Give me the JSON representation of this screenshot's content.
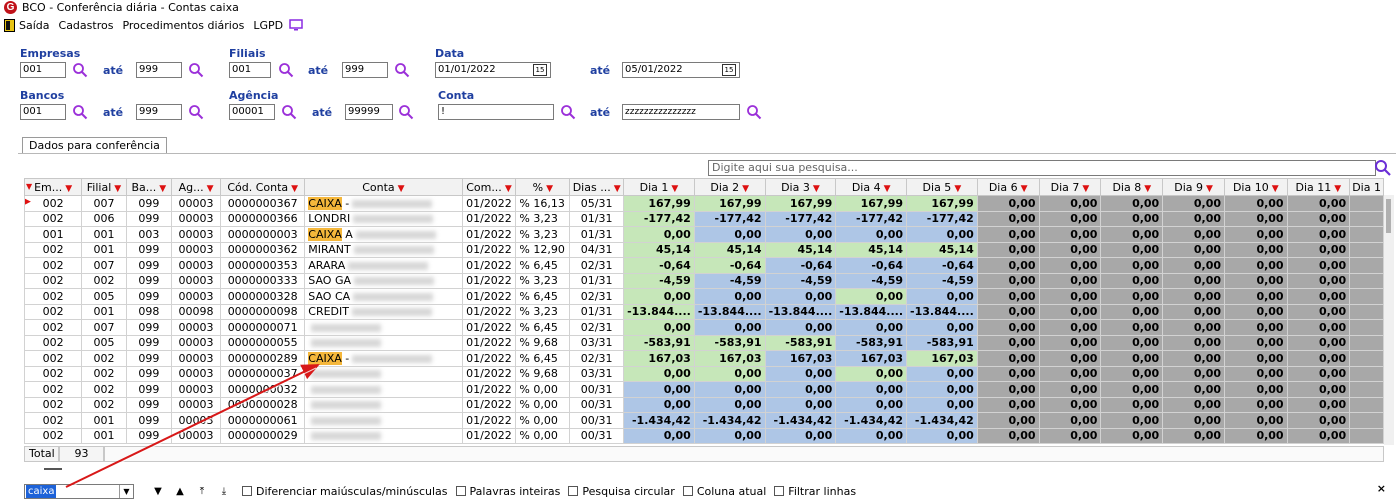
{
  "window": {
    "title": "BCO - Conferência diária - Contas caixa"
  },
  "menu": [
    "Saída",
    "Cadastros",
    "Procedimentos diários",
    "LGPD"
  ],
  "filters": {
    "empresas": {
      "label": "Empresas",
      "from": "001",
      "to": "999"
    },
    "filiais": {
      "label": "Filiais",
      "from": "001",
      "to": "999"
    },
    "data": {
      "label": "Data",
      "from": "01/01/2022",
      "to": "05/01/2022"
    },
    "bancos": {
      "label": "Bancos",
      "from": "001",
      "to": "999"
    },
    "agencia": {
      "label": "Agência",
      "from": "00001",
      "to": "99999"
    },
    "conta": {
      "label": "Conta",
      "from": "!",
      "to": "zzzzzzzzzzzzzzz"
    },
    "ate_label": "até"
  },
  "tab": {
    "label": "Dados para conferência"
  },
  "grid_search": {
    "placeholder": "Digite aqui sua pesquisa..."
  },
  "columns": [
    "Em...",
    "Filial",
    "Ba...",
    "Ag...",
    "Cód. Conta",
    "Conta",
    "Com...",
    "%",
    "Dias ...",
    "Dia 1",
    "Dia 2",
    "Dia 3",
    "Dia 4",
    "Dia 5",
    "Dia 6",
    "Dia 7",
    "Dia 8",
    "Dia 9",
    "Dia 10",
    "Dia 11",
    "Dia 1"
  ],
  "rows": [
    {
      "em": "002",
      "filial": "007",
      "banco": "099",
      "ag": "00003",
      "cod": "0000000367",
      "conta": "CAIXA -",
      "hl": "CAIXA",
      "comp": "01/2022",
      "pct": "% 16,13",
      "dias": "05/31",
      "d": [
        "167,99",
        "167,99",
        "167,99",
        "167,99",
        "167,99"
      ],
      "c": [
        "green",
        "green",
        "green",
        "green",
        "green"
      ]
    },
    {
      "em": "002",
      "filial": "006",
      "banco": "099",
      "ag": "00003",
      "cod": "0000000366",
      "conta": "LONDRI",
      "hl": "",
      "comp": "01/2022",
      "pct": "% 3,23",
      "dias": "01/31",
      "d": [
        "-177,42",
        "-177,42",
        "-177,42",
        "-177,42",
        "-177,42"
      ],
      "c": [
        "green",
        "blue",
        "blue",
        "blue",
        "blue"
      ]
    },
    {
      "em": "001",
      "filial": "001",
      "banco": "003",
      "ag": "00003",
      "cod": "0000000003",
      "conta": "CAIXA A",
      "hl": "CAIXA",
      "comp": "01/2022",
      "pct": "% 3,23",
      "dias": "01/31",
      "d": [
        "0,00",
        "0,00",
        "0,00",
        "0,00",
        "0,00"
      ],
      "c": [
        "green",
        "blue",
        "blue",
        "blue",
        "blue"
      ]
    },
    {
      "em": "002",
      "filial": "001",
      "banco": "099",
      "ag": "00003",
      "cod": "0000000362",
      "conta": "MIRANT",
      "hl": "",
      "comp": "01/2022",
      "pct": "% 12,90",
      "dias": "04/31",
      "d": [
        "45,14",
        "45,14",
        "45,14",
        "45,14",
        "45,14"
      ],
      "c": [
        "green",
        "green",
        "green",
        "green",
        "green"
      ]
    },
    {
      "em": "002",
      "filial": "007",
      "banco": "099",
      "ag": "00003",
      "cod": "0000000353",
      "conta": "ARARA",
      "hl": "",
      "comp": "01/2022",
      "pct": "% 6,45",
      "dias": "02/31",
      "d": [
        "-0,64",
        "-0,64",
        "-0,64",
        "-0,64",
        "-0,64"
      ],
      "c": [
        "green",
        "green",
        "blue",
        "blue",
        "blue"
      ]
    },
    {
      "em": "002",
      "filial": "002",
      "banco": "099",
      "ag": "00003",
      "cod": "0000000333",
      "conta": "SAO GA",
      "hl": "",
      "comp": "01/2022",
      "pct": "% 3,23",
      "dias": "01/31",
      "d": [
        "-4,59",
        "-4,59",
        "-4,59",
        "-4,59",
        "-4,59"
      ],
      "c": [
        "green",
        "blue",
        "blue",
        "blue",
        "blue"
      ]
    },
    {
      "em": "002",
      "filial": "005",
      "banco": "099",
      "ag": "00003",
      "cod": "0000000328",
      "conta": "SAO CA",
      "hl": "",
      "comp": "01/2022",
      "pct": "% 6,45",
      "dias": "02/31",
      "d": [
        "0,00",
        "0,00",
        "0,00",
        "0,00",
        "0,00"
      ],
      "c": [
        "green",
        "blue",
        "blue",
        "green",
        "blue"
      ]
    },
    {
      "em": "002",
      "filial": "001",
      "banco": "098",
      "ag": "00098",
      "cod": "0000000098",
      "conta": "CREDIT",
      "hl": "",
      "comp": "01/2022",
      "pct": "% 3,23",
      "dias": "01/31",
      "d": [
        "-13.844....",
        "-13.844....",
        "-13.844....",
        "-13.844....",
        "-13.844...."
      ],
      "c": [
        "green",
        "blue",
        "blue",
        "blue",
        "blue"
      ]
    },
    {
      "em": "002",
      "filial": "007",
      "banco": "099",
      "ag": "00003",
      "cod": "0000000071",
      "conta": "",
      "hl": "",
      "comp": "01/2022",
      "pct": "% 6,45",
      "dias": "02/31",
      "d": [
        "0,00",
        "0,00",
        "0,00",
        "0,00",
        "0,00"
      ],
      "c": [
        "green",
        "blue",
        "blue",
        "blue",
        "blue"
      ]
    },
    {
      "em": "002",
      "filial": "005",
      "banco": "099",
      "ag": "00003",
      "cod": "0000000055",
      "conta": "",
      "hl": "",
      "comp": "01/2022",
      "pct": "% 9,68",
      "dias": "03/31",
      "d": [
        "-583,91",
        "-583,91",
        "-583,91",
        "-583,91",
        "-583,91"
      ],
      "c": [
        "green",
        "green",
        "green",
        "blue",
        "blue"
      ]
    },
    {
      "em": "002",
      "filial": "002",
      "banco": "099",
      "ag": "00003",
      "cod": "0000000289",
      "conta": "CAIXA -",
      "hl": "CAIXA",
      "comp": "01/2022",
      "pct": "% 6,45",
      "dias": "02/31",
      "d": [
        "167,03",
        "167,03",
        "167,03",
        "167,03",
        "167,03"
      ],
      "c": [
        "green",
        "green",
        "blue",
        "blue",
        "green"
      ]
    },
    {
      "em": "002",
      "filial": "002",
      "banco": "099",
      "ag": "00003",
      "cod": "0000000037",
      "conta": "",
      "hl": "",
      "comp": "01/2022",
      "pct": "% 9,68",
      "dias": "03/31",
      "d": [
        "0,00",
        "0,00",
        "0,00",
        "0,00",
        "0,00"
      ],
      "c": [
        "green",
        "green",
        "blue",
        "green",
        "blue"
      ]
    },
    {
      "em": "002",
      "filial": "002",
      "banco": "099",
      "ag": "00003",
      "cod": "0000000032",
      "conta": "",
      "hl": "",
      "comp": "01/2022",
      "pct": "% 0,00",
      "dias": "00/31",
      "d": [
        "0,00",
        "0,00",
        "0,00",
        "0,00",
        "0,00"
      ],
      "c": [
        "blue",
        "blue",
        "blue",
        "blue",
        "blue"
      ]
    },
    {
      "em": "002",
      "filial": "002",
      "banco": "099",
      "ag": "00003",
      "cod": "0000000028",
      "conta": "",
      "hl": "",
      "comp": "01/2022",
      "pct": "% 0,00",
      "dias": "00/31",
      "d": [
        "0,00",
        "0,00",
        "0,00",
        "0,00",
        "0,00"
      ],
      "c": [
        "blue",
        "blue",
        "blue",
        "blue",
        "blue"
      ]
    },
    {
      "em": "002",
      "filial": "001",
      "banco": "099",
      "ag": "00003",
      "cod": "0000000061",
      "conta": "",
      "hl": "",
      "comp": "01/2022",
      "pct": "% 0,00",
      "dias": "00/31",
      "d": [
        "-1.434,42",
        "-1.434,42",
        "-1.434,42",
        "-1.434,42",
        "-1.434,42"
      ],
      "c": [
        "blue",
        "blue",
        "blue",
        "blue",
        "blue"
      ]
    },
    {
      "em": "002",
      "filial": "001",
      "banco": "099",
      "ag": "00003",
      "cod": "0000000029",
      "conta": "",
      "hl": "",
      "comp": "01/2022",
      "pct": "% 0,00",
      "dias": "00/31",
      "d": [
        "0,00",
        "0,00",
        "0,00",
        "0,00",
        "0,00"
      ],
      "c": [
        "blue",
        "blue",
        "blue",
        "blue",
        "blue"
      ]
    }
  ],
  "zero_value": "0,00",
  "totals": {
    "label": "Total",
    "count": "93"
  },
  "bottom": {
    "search_value": "caixa",
    "options": [
      "Diferenciar maiúsculas/minúsculas",
      "Palavras inteiras",
      "Pesquisa circular",
      "Coluna atual",
      "Filtrar linhas"
    ],
    "close": "×"
  },
  "colors": {
    "label_blue": "#1f3fa0",
    "green_cell": "#c6e7b9",
    "blue_cell": "#aec6e6",
    "gray_cell": "#a8a8a8",
    "highlight": "#f5b73b",
    "arrow": "#d81818"
  }
}
